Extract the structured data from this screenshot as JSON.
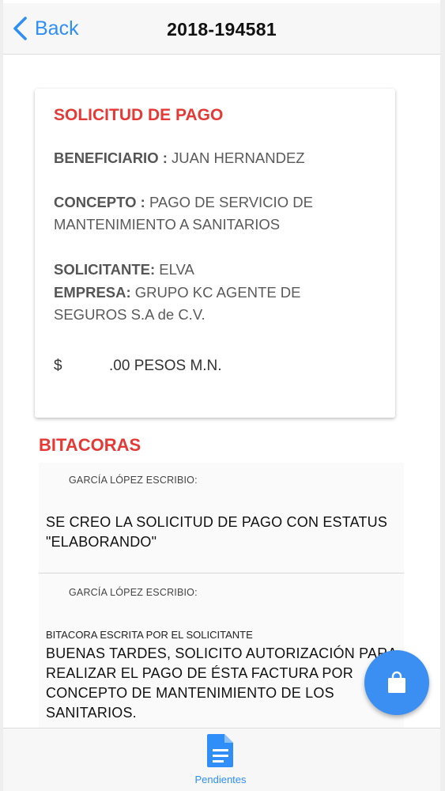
{
  "header": {
    "back_label": "Back",
    "title": "2018-194581"
  },
  "card": {
    "title": "SOLICITUD DE PAGO",
    "beneficiario_label": "BENEFICIARIO :",
    "beneficiario_value": "JUAN HERNANDEZ",
    "concepto_label": "CONCEPTO :",
    "concepto_value": "PAGO DE SERVICIO DE MANTENIMIENTO A SANITARIOS",
    "solicitante_label": "SOLICITANTE:",
    "solicitante_value": "ELVA",
    "empresa_label": "EMPRESA:",
    "empresa_value": "GRUPO KC AGENTE DE SEGUROS S.A de C.V.",
    "currency": "$",
    "amount": ".00 PESOS M.N."
  },
  "bitacoras": {
    "title": "BITACORAS",
    "entries": [
      {
        "author": "GARCÍA LÓPEZ ESCRIBIO:",
        "subtitle": "",
        "text": "SE CREO LA SOLICITUD DE PAGO CON ESTATUS \"ELABORANDO\""
      },
      {
        "author": "GARCÍA LÓPEZ ESCRIBIO:",
        "subtitle": "BITACORA ESCRITA POR EL SOLICITANTE",
        "text": "BUENAS TARDES, SOLICITO AUTORIZACIÓN PARA REALIZAR EL PAGO DE ÉSTA FACTURA POR CONCEPTO DE MANTENIMIENTO DE LOS SANITARIOS."
      }
    ]
  },
  "fab": {
    "icon": "shopping-bag-icon"
  },
  "bottom_nav": {
    "tabs": [
      {
        "label": "Pendientes",
        "icon": "document-icon",
        "active": true
      }
    ]
  },
  "colors": {
    "accent": "#2f8ef7",
    "title_red": "#e53935",
    "fab": "#3b8ff2"
  }
}
